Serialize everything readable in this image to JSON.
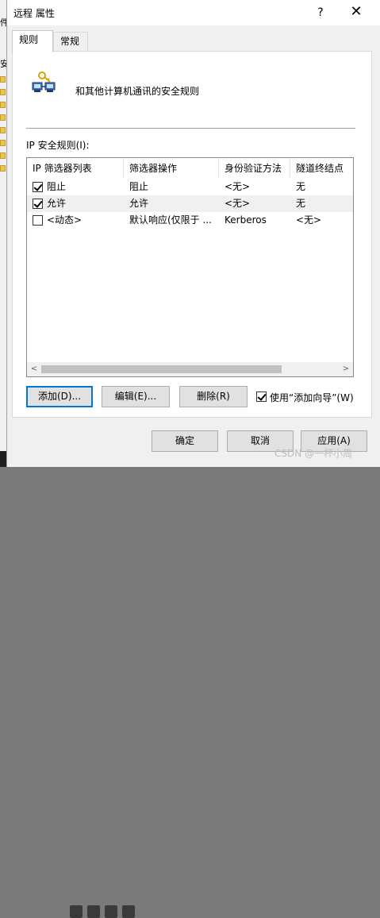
{
  "window": {
    "title": "远程 属性",
    "help_glyph": "?",
    "close_glyph": "✕"
  },
  "background": {
    "char1": "件",
    "char2": "安"
  },
  "tabs": [
    {
      "label": "规则"
    },
    {
      "label": "常规"
    }
  ],
  "header": {
    "description": "和其他计算机通讯的安全规则"
  },
  "list": {
    "label": "IP 安全规则(I):",
    "columns": [
      "IP 筛选器列表",
      "筛选器操作",
      "身份验证方法",
      "隧道终结点"
    ],
    "rows": [
      {
        "checked": true,
        "filter_list": "阻止",
        "action": "阻止",
        "auth": "<无>",
        "tunnel": "无"
      },
      {
        "checked": true,
        "filter_list": "允许",
        "action": "允许",
        "auth": "<无>",
        "tunnel": "无"
      },
      {
        "checked": false,
        "filter_list": "<动态>",
        "action": "默认响应(仅限于 ...",
        "auth": "Kerberos",
        "tunnel": "<无>"
      }
    ],
    "scroll_left": "<",
    "scroll_right": ">"
  },
  "buttons": {
    "add": "添加(D)...",
    "edit": "编辑(E)...",
    "delete": "删除(R)"
  },
  "wizard": {
    "checked": true,
    "label": "使用“添加向导”(W)"
  },
  "footer": {
    "ok": "确定",
    "cancel": "取消",
    "apply": "应用(A)"
  },
  "watermark": "CSDN @一杯小周"
}
